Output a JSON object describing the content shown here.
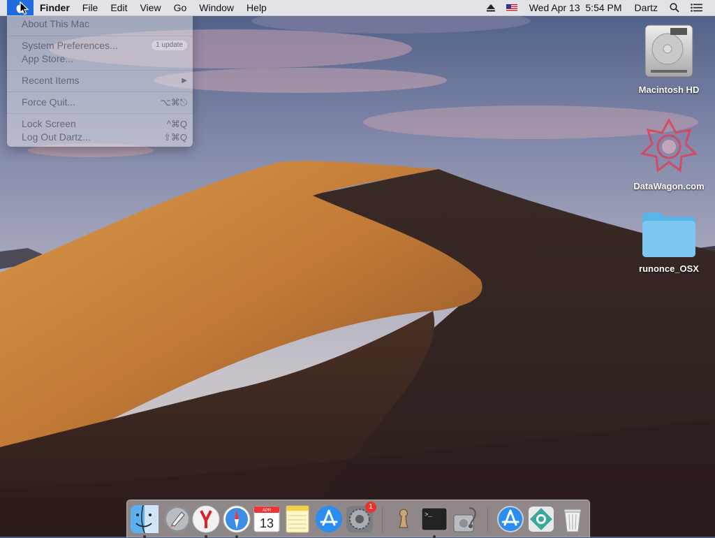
{
  "menubar": {
    "app_name": "Finder",
    "menus": [
      "File",
      "Edit",
      "View",
      "Go",
      "Window",
      "Help"
    ],
    "datetime": "Wed Apr 13  5:54 PM",
    "user": "Dartz"
  },
  "apple_menu": {
    "about": "About This Mac",
    "system_prefs": "System Preferences...",
    "system_prefs_badge": "1 update",
    "app_store": "App Store...",
    "recent_items": "Recent Items",
    "recent_items_arrow": "▶",
    "force_quit": "Force Quit...",
    "force_quit_shortcut": "⌥⌘⎋",
    "lock_screen": "Lock Screen",
    "lock_screen_shortcut": "^⌘Q",
    "log_out": "Log Out Dartz...",
    "log_out_shortcut": "⇧⌘Q"
  },
  "desktop_icons": {
    "hd": "Macintosh HD",
    "datawagon": "DataWagon.com",
    "folder": "runonce_OSX"
  },
  "dock": {
    "apps": [
      "finder-icon",
      "launchpad-icon",
      "yandex-browser-icon",
      "safari-icon",
      "calendar-icon",
      "notes-icon",
      "app-store-icon",
      "system-preferences-icon",
      "chess-icon",
      "terminal-icon",
      "disk-utility-icon",
      "app-store-installer-icon",
      "sourcetree-icon",
      "trash-icon"
    ],
    "calendar_month": "APR",
    "calendar_day": "13",
    "sysprefs_badge": "1",
    "terminal_prompt": ">_"
  },
  "colors": {
    "apple_highlight": "#1f6be0",
    "folder_blue": "#6ec1f0",
    "badge_red": "#e6352d"
  }
}
